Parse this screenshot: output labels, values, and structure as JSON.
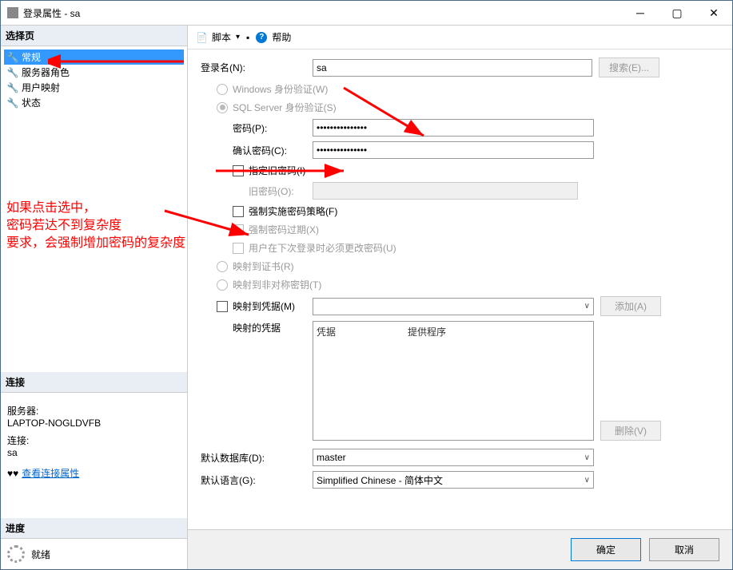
{
  "window": {
    "title": "登录属性 - sa"
  },
  "leftpane": {
    "select_page_header": "选择页",
    "pages": [
      "常规",
      "服务器角色",
      "用户映射",
      "状态"
    ],
    "connection_header": "连接",
    "server_label": "服务器:",
    "server_value": "LAPTOP-NOGLDVFB",
    "conn_label": "连接:",
    "conn_value": "sa",
    "view_conn_props": "查看连接属性",
    "progress_header": "进度",
    "progress_status": "就绪"
  },
  "toolbar": {
    "script": "脚本",
    "help": "帮助"
  },
  "form": {
    "login_name_label": "登录名(N):",
    "login_name_value": "sa",
    "search_btn": "搜索(E)...",
    "win_auth": "Windows 身份验证(W)",
    "sql_auth": "SQL Server 身份验证(S)",
    "password_label": "密码(P):",
    "password_value": "●●●●●●●●●●●●●●●",
    "confirm_pwd_label": "确认密码(C):",
    "confirm_pwd_value": "●●●●●●●●●●●●●●●",
    "specify_old_pwd": "指定旧密码(I)",
    "old_pwd_label": "旧密码(O):",
    "enforce_policy": "强制实施密码策略(F)",
    "enforce_expiry": "强制密码过期(X)",
    "must_change": "用户在下次登录时必须更改密码(U)",
    "map_cert": "映射到证书(R)",
    "map_asym": "映射到非对称密钥(T)",
    "map_cred": "映射到凭据(M)",
    "add_btn": "添加(A)",
    "mapped_creds_label": "映射的凭据",
    "col_cred": "凭据",
    "col_provider": "提供程序",
    "remove_btn": "删除(V)",
    "default_db_label": "默认数据库(D):",
    "default_db_value": "master",
    "default_lang_label": "默认语言(G):",
    "default_lang_value": "Simplified Chinese - 简体中文"
  },
  "buttons": {
    "ok": "确定",
    "cancel": "取消"
  },
  "annotations": {
    "note": "如果点击选中，\n密码若达不到复杂度\n要求，会强制增加密码的复杂度"
  }
}
